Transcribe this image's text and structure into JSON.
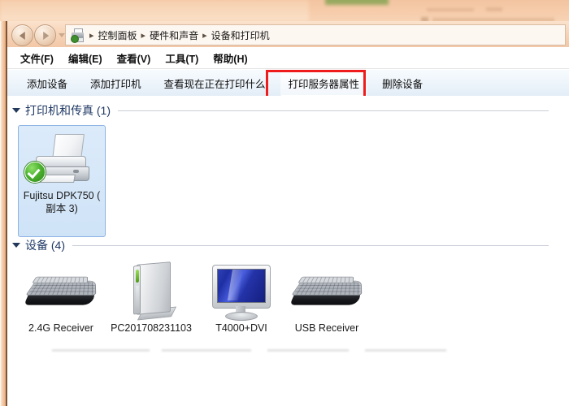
{
  "window": {
    "title_strip": "blurred-background"
  },
  "addressbar": {
    "back_label": "后退",
    "forward_label": "前进",
    "recent_pages_label": "最近浏览的页面",
    "icon": "printer-icon",
    "separator": "▸",
    "breadcrumbs": [
      {
        "label": "控制面板"
      },
      {
        "label": "硬件和声音"
      },
      {
        "label": "设备和打印机"
      }
    ]
  },
  "menubar": {
    "items": [
      {
        "label": "文件(F)"
      },
      {
        "label": "编辑(E)"
      },
      {
        "label": "查看(V)"
      },
      {
        "label": "工具(T)"
      },
      {
        "label": "帮助(H)"
      }
    ]
  },
  "toolbar": {
    "items": [
      {
        "label": "添加设备",
        "highlighted": false
      },
      {
        "label": "添加打印机",
        "highlighted": false
      },
      {
        "label": "查看现在正在打印什么",
        "highlighted": false
      },
      {
        "label": "打印服务器属性",
        "highlighted": true
      },
      {
        "label": "删除设备",
        "highlighted": false
      }
    ],
    "highlight_color": "#ee1c1c"
  },
  "content": {
    "groups": [
      {
        "title": "打印机和传真 (1)",
        "collapse_icon": "triangle-down-icon",
        "items": [
          {
            "label": "Fujitsu DPK750 ( 副本 3)",
            "icon": "printer-icon",
            "badge": "default-printer-check-icon",
            "selected": true
          }
        ]
      },
      {
        "title": "设备 (4)",
        "collapse_icon": "triangle-down-icon",
        "items": [
          {
            "label": "2.4G Receiver",
            "icon": "keyboard-icon",
            "selected": false
          },
          {
            "label": "PC201708231103",
            "icon": "computer-tower-icon",
            "selected": false
          },
          {
            "label": "T4000+DVI",
            "icon": "monitor-icon",
            "selected": false
          },
          {
            "label": "USB Receiver",
            "icon": "keyboard-icon",
            "selected": false
          }
        ]
      }
    ]
  },
  "colors": {
    "accent": "#1f3864",
    "selection": "#cfe3f7",
    "selection_border": "#8db2e3",
    "chrome_tan": "#f2c8a8",
    "toolbar_blue": "#e3edf7",
    "annotation_red": "#ee1c1c",
    "default_badge_green": "#4fb531"
  }
}
